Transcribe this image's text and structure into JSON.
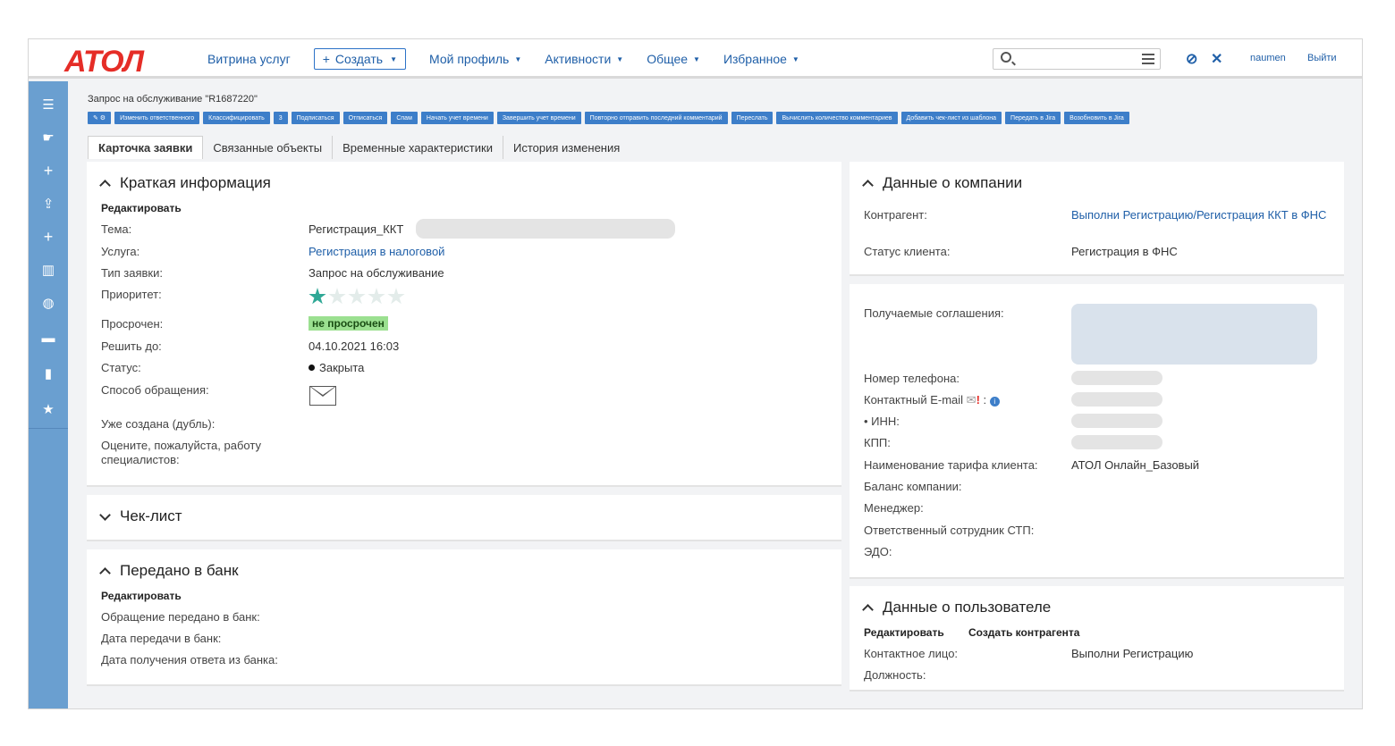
{
  "header": {
    "logo": "ATOЛ",
    "nav": [
      {
        "label": "Витрина услуг"
      },
      {
        "label": "Создать",
        "type": "button"
      },
      {
        "label": "Мой профиль"
      },
      {
        "label": "Активности"
      },
      {
        "label": "Общее"
      },
      {
        "label": "Избранное"
      }
    ],
    "search_placeholder": "",
    "user": "naumen",
    "logout": "Выйти"
  },
  "sidebar": {
    "items": [
      "menu-icon",
      "pointer-icon",
      "plus-icon",
      "export-icon",
      "plus-icon",
      "chart-icon",
      "globe-icon",
      "monitor-icon",
      "book-icon",
      "star-icon"
    ]
  },
  "breadcrumb": "Запрос на обслуживание \"R1687220\"",
  "toolbar": [
    "✎ ⚙",
    "Изменить ответственного",
    "Классифицировать",
    "3",
    "Подписаться",
    "Отписаться",
    "Спам",
    "Начать учет времени",
    "Завершить учет времени",
    "Повторно отправить последний комментарий",
    "Переслать",
    "Вычислить количество комментариев",
    "Добавить чек-лист из шаблона",
    "Передать в Jira",
    "Возобновить в Jira"
  ],
  "tabs": [
    "Карточка заявки",
    "Связанные объекты",
    "Временные характеристики",
    "История изменения"
  ],
  "brief": {
    "title": "Краткая информация",
    "edit": "Редактировать",
    "labels": {
      "subject": "Тема:",
      "service": "Услуга:",
      "type": "Тип заявки:",
      "priority": "Приоритет:",
      "overdue": "Просрочен:",
      "due": "Решить до:",
      "status": "Статус:",
      "channel": "Способ обращения:",
      "duplicate": "Уже создана (дубль):",
      "rate": "Оцените, пожалуйста, работу специалистов:"
    },
    "values": {
      "subject": "Регистрация_ККТ",
      "service": "Регистрация в налоговой",
      "type": "Запрос на обслуживание",
      "priority_stars": 1,
      "priority_max": 5,
      "overdue": "не просрочен",
      "due": "04.10.2021 16:03",
      "status": "Закрыта"
    }
  },
  "checklist": {
    "title": "Чек-лист"
  },
  "bank": {
    "title": "Передано в банк",
    "edit": "Редактировать",
    "labels": [
      "Обращение передано в банк:",
      "Дата передачи в банк:",
      "Дата получения ответа из банка:"
    ]
  },
  "company": {
    "title": "Данные о компании",
    "counterparty_label": "Контрагент:",
    "counterparty_value": "Выполни Регистрацию/Регистрация ККТ в ФНС",
    "client_status_label": "Статус клиента:",
    "client_status_value": "Регистрация в ФНС"
  },
  "agreements": {
    "label": "Получаемые соглашения:",
    "phone": "Номер телефона:",
    "email": "Контактный E-mail",
    "email_mark": "!",
    "inn": "• ИНН:",
    "kpp": "КПП:",
    "tariff_label": "Наименование тарифа клиента:",
    "tariff_value": "АТОЛ Онлайн_Базовый",
    "balance": "Баланс компании:",
    "manager": "Менеджер:",
    "responsible": "Ответственный сотрудник СТП:",
    "edo": "ЭДО:"
  },
  "user": {
    "title": "Данные о пользователе",
    "edit": "Редактировать",
    "create": "Создать контрагента",
    "contact_label": "Контактное лицо:",
    "contact_value": "Выполни Регистрацию",
    "position_label": "Должность:"
  }
}
